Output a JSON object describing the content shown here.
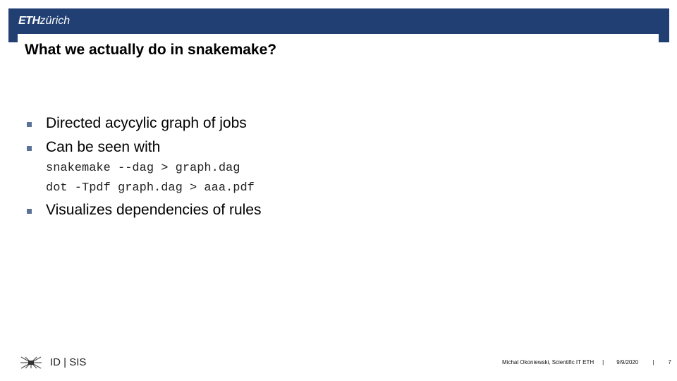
{
  "header": {
    "logo_bold": "ETH",
    "logo_light": "zürich",
    "brand_color": "#213f73"
  },
  "slide": {
    "title": "What we actually do in snakemake?",
    "bullets": [
      {
        "text": "Directed acycylic graph of jobs"
      },
      {
        "text": "Can be seen with"
      },
      {
        "text": "Visualizes dependencies of rules"
      }
    ],
    "code_lines": [
      "snakemake --dag > graph.dag",
      "dot -Tpdf graph.dag > aaa.pdf"
    ],
    "bullet_color": "#5a7296"
  },
  "footer": {
    "department": "ID | SIS",
    "author": "Michal Okoniewski, Scientific IT ETH",
    "separator": "|",
    "date": "9/9/2020",
    "page_number": "7"
  }
}
